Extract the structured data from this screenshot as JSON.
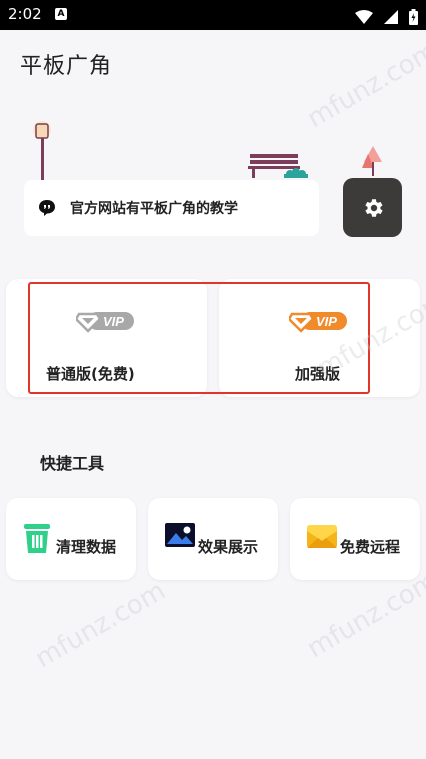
{
  "status_bar": {
    "time": "2:02",
    "app_badge": "A"
  },
  "app": {
    "title": "平板广角"
  },
  "notice": {
    "text": "官方网站有平板广角的教学"
  },
  "versions": [
    {
      "badge": "VIP",
      "label": "普通版(免费)",
      "color": "#9d9d9d"
    },
    {
      "badge": "VIP",
      "label": "加强版",
      "color": "#f08a2a"
    }
  ],
  "tools": {
    "section_title": "快捷工具",
    "items": [
      {
        "label": "清理数据",
        "icon": "trash-icon"
      },
      {
        "label": "效果展示",
        "icon": "image-icon"
      },
      {
        "label": "免费远程",
        "icon": "envelope-icon"
      }
    ]
  },
  "watermark": "mfunz.com"
}
